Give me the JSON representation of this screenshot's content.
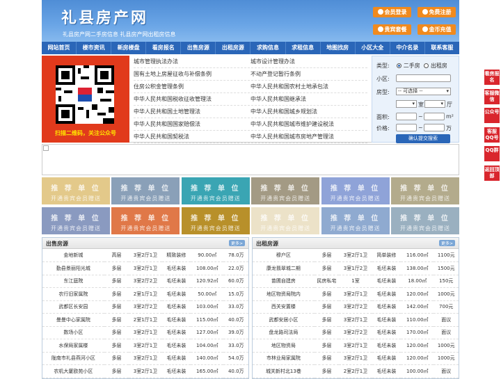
{
  "header": {
    "title": "礼县房产网",
    "subtitle": "礼县房产网二手房信息   礼县房产网出租房信息",
    "buttons": [
      "会员登录",
      "免费注册",
      "贵宾套餐",
      "金币充值"
    ]
  },
  "nav": [
    "网站首页",
    "楼市资讯",
    "新房楼盘",
    "看房报名",
    "出售房源",
    "出租房源",
    "求购信息",
    "求租信息",
    "地图找房",
    "小区大全",
    "中介名录",
    "联系客服"
  ],
  "qr": {
    "caption": "扫描二维码，关注公众号"
  },
  "links": [
    [
      "城市管理执法办法",
      "城市设计管理办法"
    ],
    [
      "国有土地上房屋征收与补偿条例",
      "不动产登记暂行条例"
    ],
    [
      "住房公积金管理条例",
      "中华人民共和国农村土地承包法"
    ],
    [
      "中华人民共和国税收征收管理法",
      "中华人民共和国继承法"
    ],
    [
      "中华人民共和国土地管理法",
      "中华人民共和国城乡规划法"
    ],
    [
      "中华人民共和国国家赔偿法",
      "中华人民共和国城市维护建设税法"
    ],
    [
      "中华人民共和国契税法",
      "中华人民共和国城市房地产管理法"
    ]
  ],
  "search": {
    "type_label": "类型:",
    "opt_sale": "二手房",
    "opt_rent": "出租房",
    "community_label": "小区:",
    "housetype_label": "房型:",
    "housetype_value": "-- 可选择 --",
    "room_unit": "室",
    "hall_unit": "厅",
    "area_label": "面积:",
    "area_unit": "m²",
    "price_label": "价格:",
    "price_unit": "万",
    "tilde": "~",
    "submit": "确认提交搜索"
  },
  "ads": {
    "title": "推 荐 单 位",
    "subtitle": "开通贵宾会员赠送",
    "colors": [
      "#e3c98a",
      "#8aa0b8",
      "#3aa5b3",
      "#a39a84",
      "#8fa3d8",
      "#b3ab8c",
      "#8a9ac0",
      "#e07848",
      "#b8902a",
      "#ece2c8",
      "#8faad0",
      "#9ab0c0"
    ]
  },
  "sale": {
    "title": "出售房源",
    "more": "更多>",
    "rows": [
      [
        "金地新城",
        "高层",
        "3室2厅1卫",
        "精致装修",
        "90.00㎡",
        "78.0万"
      ],
      [
        "勤县景丽阳光城",
        "多层",
        "3室2厅1卫",
        "毛坯未装",
        "108.00㎡",
        "22.0万"
      ],
      [
        "东江庭院",
        "多层",
        "3室2厅2卫",
        "毛坯未装",
        "120.92㎡",
        "60.0万"
      ],
      [
        "农行旧家属院",
        "多层",
        "2室1厅1卫",
        "毛坯未装",
        "50.00㎡",
        "15.0万"
      ],
      [
        "武都区长安园",
        "多层",
        "3室2厅2卫",
        "毛坯未装",
        "103.00㎡",
        "33.0万"
      ],
      [
        "曼曼中心家属院",
        "多层",
        "2室1厅1卫",
        "毛坯未装",
        "115.00㎡",
        "40.0万"
      ],
      [
        "数场小区",
        "多层",
        "3室2厅1卫",
        "毛坯未装",
        "127.00㎡",
        "39.0万"
      ],
      [
        "水保局家属楼",
        "多层",
        "3室2厅1卫",
        "毛坯未装",
        "104.00㎡",
        "33.0万"
      ],
      [
        "陇南市礼县燕河小区",
        "多层",
        "3室2厅1卫",
        "毛坯未装",
        "140.00㎡",
        "54.0万"
      ],
      [
        "农机大厦欧苑小区",
        "多层",
        "3室2厅1卫",
        "毛坯未装",
        "165.00㎡",
        "40.0万"
      ]
    ]
  },
  "rent": {
    "title": "出租房源",
    "more": "更多>",
    "rows": [
      [
        "穆户区",
        "多层",
        "3室2厅1卫",
        "简单装修",
        "116.00㎡",
        "1100元"
      ],
      [
        "康龙翡翠城二期",
        "多层",
        "3室1厅2卫",
        "毛坯未装",
        "138.00㎡",
        "1500元"
      ],
      [
        "苗圃自建房",
        "民房私宅",
        "1室",
        "毛坯未装",
        "18.00㎡",
        "150元"
      ],
      [
        "地区物资局院内",
        "多层",
        "3室2厅1卫",
        "毛坯未装",
        "120.00㎡",
        "1000元"
      ],
      [
        "西关安置楼",
        "多层",
        "3室2厅2卫",
        "毛坯未装",
        "142.00㎡",
        "700元"
      ],
      [
        "武都安居小区",
        "多层",
        "3室2厅1卫",
        "毛坯未装",
        "110.00㎡",
        "面议"
      ],
      [
        "盘龙路司法局",
        "多层",
        "3室2厅2卫",
        "毛坯未装",
        "170.00㎡",
        "面议"
      ],
      [
        "地区物资局",
        "多层",
        "3室2厅1卫",
        "毛坯未装",
        "120.00㎡",
        "1000元"
      ],
      [
        "市林业局家属院",
        "多层",
        "3室2厅1卫",
        "毛坯未装",
        "120.00㎡",
        "1000元"
      ],
      [
        "城关新村北13巷",
        "多层",
        "2室2厅1卫",
        "毛坯未装",
        "100.00㎡",
        "面议"
      ]
    ]
  },
  "side": [
    "看房报名",
    "客服微信",
    "公众号",
    "客服QQ号",
    "QQ群",
    "返回顶部"
  ]
}
